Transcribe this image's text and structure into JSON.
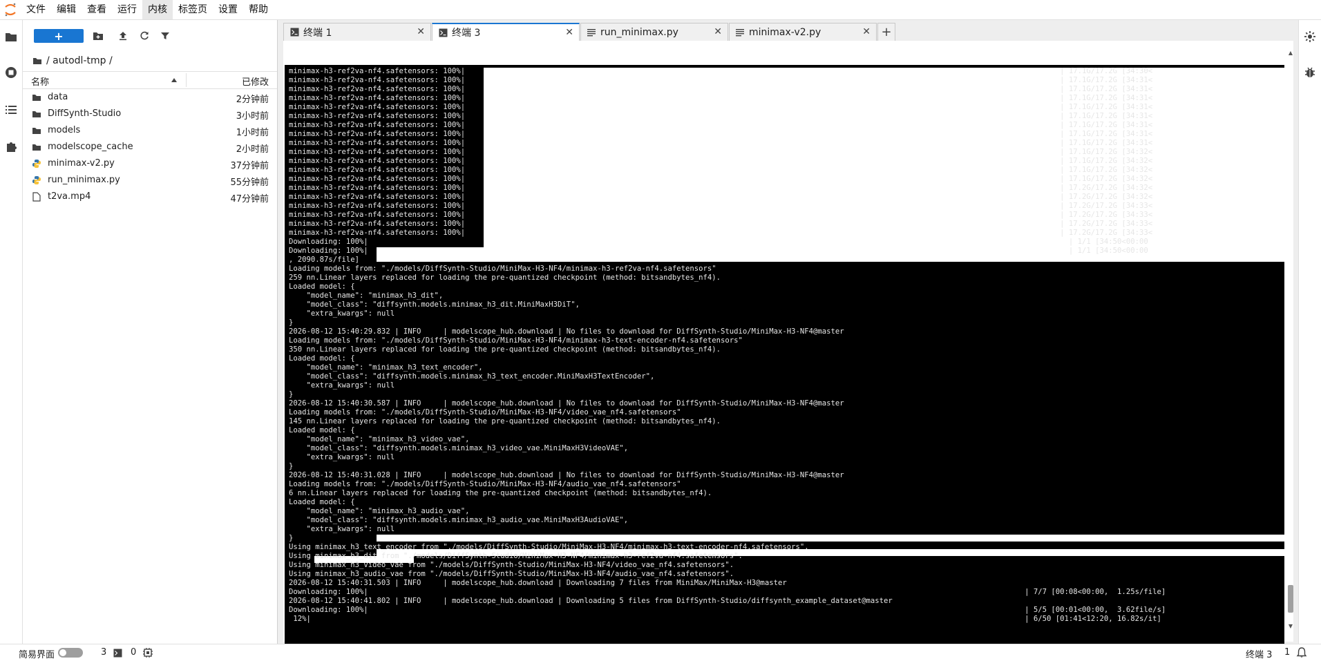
{
  "menubar": {
    "items": [
      "文件",
      "编辑",
      "查看",
      "运行",
      "内核",
      "标签页",
      "设置",
      "帮助"
    ],
    "active": "内核",
    "logo_icon": "jupyter-logo-icon"
  },
  "colors": {
    "accent": "#1976d2",
    "python": "#3776ab",
    "terminal_bg": "#000000"
  },
  "file_browser": {
    "new_button": "+",
    "breadcrumb": "/ autodl-tmp /",
    "columns": {
      "name": "名称",
      "modified": "已修改"
    },
    "files": [
      {
        "name": "data",
        "type": "folder",
        "modified": "2分钟前"
      },
      {
        "name": "DiffSynth-Studio",
        "type": "folder",
        "modified": "3小时前"
      },
      {
        "name": "models",
        "type": "folder",
        "modified": "1小时前"
      },
      {
        "name": "modelscope_cache",
        "type": "folder",
        "modified": "2小时前"
      },
      {
        "name": "minimax-v2.py",
        "type": "python",
        "modified": "37分钟前"
      },
      {
        "name": "run_minimax.py",
        "type": "python",
        "modified": "55分钟前"
      },
      {
        "name": "t2va.mp4",
        "type": "file",
        "modified": "47分钟前"
      }
    ]
  },
  "tabs": [
    {
      "label": "终端 1",
      "icon": "terminal-icon",
      "active": false
    },
    {
      "label": "终端 3",
      "icon": "terminal-icon",
      "active": true
    },
    {
      "label": "run_minimax.py",
      "icon": "text-file-icon",
      "active": false
    },
    {
      "label": "minimax-v2.py",
      "icon": "text-file-icon",
      "active": false
    }
  ],
  "add_tab_label": "+",
  "terminal": {
    "lines": [
      "minimax-h3-ref2va-nf4.safetensors: 100%|                                                                                                                                       | 17.1G/17.2G [34:30<",
      "minimax-h3-ref2va-nf4.safetensors: 100%|                                                                                                                                       | 17.1G/17.2G [34:31<",
      "minimax-h3-ref2va-nf4.safetensors: 100%|                                                                                                                                       | 17.1G/17.2G [34:31<",
      "minimax-h3-ref2va-nf4.safetensors: 100%|                                                                                                                                       | 17.1G/17.2G [34:31<",
      "minimax-h3-ref2va-nf4.safetensors: 100%|                                                                                                                                       | 17.1G/17.2G [34:31<",
      "minimax-h3-ref2va-nf4.safetensors: 100%|                                                                                                                                       | 17.1G/17.2G [34:31<",
      "minimax-h3-ref2va-nf4.safetensors: 100%|                                                                                                                                       | 17.1G/17.2G [34:31<",
      "minimax-h3-ref2va-nf4.safetensors: 100%|                                                                                                                                       | 17.1G/17.2G [34:31<",
      "minimax-h3-ref2va-nf4.safetensors: 100%|                                                                                                                                       | 17.1G/17.2G [34:31<",
      "minimax-h3-ref2va-nf4.safetensors: 100%|                                                                                                                                       | 17.1G/17.2G [34:32<",
      "minimax-h3-ref2va-nf4.safetensors: 100%|                                                                                                                                       | 17.1G/17.2G [34:32<",
      "minimax-h3-ref2va-nf4.safetensors: 100%|                                                                                                                                       | 17.1G/17.2G [34:32<",
      "minimax-h3-ref2va-nf4.safetensors: 100%|                                                                                                                                       | 17.1G/17.2G [34:32<",
      "minimax-h3-ref2va-nf4.safetensors: 100%|                                                                                                                                       | 17.2G/17.2G [34:32<",
      "minimax-h3-ref2va-nf4.safetensors: 100%|                                                                                                                                       | 17.2G/17.2G [34:32<",
      "minimax-h3-ref2va-nf4.safetensors: 100%|                                                                                                                                       | 17.2G/17.2G [34:33<",
      "minimax-h3-ref2va-nf4.safetensors: 100%|                                                                                                                                       | 17.2G/17.2G [34:33<",
      "minimax-h3-ref2va-nf4.safetensors: 100%|                                                                                                                                       | 17.2G/17.2G [34:33<",
      "minimax-h3-ref2va-nf4.safetensors: 100%|                                                                                                                                       | 17.2G/17.2G [34:33<",
      "Downloading: 100%|                                                                                                                                                               | 1/1 [34:50<00:00",
      "Downloading: 100%|                                                                                                                                                               | 1/1 [34:50<00:00",
      ", 2090.87s/file]",
      "Loading models from: \"./models/DiffSynth-Studio/MiniMax-H3-NF4/minimax-h3-ref2va-nf4.safetensors\"",
      "259 nn.Linear layers replaced for loading the pre-quantized checkpoint (method: bitsandbytes_nf4).",
      "Loaded model: {",
      "    \"model_name\": \"minimax_h3_dit\",",
      "    \"model_class\": \"diffsynth.models.minimax_h3_dit.MiniMaxH3DiT\",",
      "    \"extra_kwargs\": null",
      "}",
      "2026-08-12 15:40:29.832 | INFO     | modelscope_hub.download | No files to download for DiffSynth-Studio/MiniMax-H3-NF4@master",
      "Loading models from: \"./models/DiffSynth-Studio/MiniMax-H3-NF4/minimax-h3-text-encoder-nf4.safetensors\"",
      "350 nn.Linear layers replaced for loading the pre-quantized checkpoint (method: bitsandbytes_nf4).",
      "Loaded model: {",
      "    \"model_name\": \"minimax_h3_text_encoder\",",
      "    \"model_class\": \"diffsynth.models.minimax_h3_text_encoder.MiniMaxH3TextEncoder\",",
      "    \"extra_kwargs\": null",
      "}",
      "2026-08-12 15:40:30.587 | INFO     | modelscope_hub.download | No files to download for DiffSynth-Studio/MiniMax-H3-NF4@master",
      "Loading models from: \"./models/DiffSynth-Studio/MiniMax-H3-NF4/video_vae_nf4.safetensors\"",
      "145 nn.Linear layers replaced for loading the pre-quantized checkpoint (method: bitsandbytes_nf4).",
      "Loaded model: {",
      "    \"model_name\": \"minimax_h3_video_vae\",",
      "    \"model_class\": \"diffsynth.models.minimax_h3_video_vae.MiniMaxH3VideoVAE\",",
      "    \"extra_kwargs\": null",
      "}",
      "2026-08-12 15:40:31.028 | INFO     | modelscope_hub.download | No files to download for DiffSynth-Studio/MiniMax-H3-NF4@master",
      "Loading models from: \"./models/DiffSynth-Studio/MiniMax-H3-NF4/audio_vae_nf4.safetensors\"",
      "6 nn.Linear layers replaced for loading the pre-quantized checkpoint (method: bitsandbytes_nf4).",
      "Loaded model: {",
      "    \"model_name\": \"minimax_h3_audio_vae\",",
      "    \"model_class\": \"diffsynth.models.minimax_h3_audio_vae.MiniMaxH3AudioVAE\",",
      "    \"extra_kwargs\": null",
      "}",
      "Using minimax_h3_text_encoder from \"./models/DiffSynth-Studio/MiniMax-H3-NF4/minimax-h3-text-encoder-nf4.safetensors\".",
      "Using minimax_h3_dit from \"./models/DiffSynth-Studio/MiniMax-H3-NF4/minimax-h3-ref2va-nf4.safetensors\".",
      "Using minimax_h3_video_vae from \"./models/DiffSynth-Studio/MiniMax-H3-NF4/video_vae_nf4.safetensors\".",
      "Using minimax_h3_audio_vae from \"./models/DiffSynth-Studio/MiniMax-H3-NF4/audio_vae_nf4.safetensors\".",
      "2026-08-12 15:40:31.503 | INFO     | modelscope_hub.download | Downloading 7 files from MiniMax/MiniMax-H3@master",
      "Downloading: 100%|                                                                                                                                                     | 7/7 [00:08<00:00,  1.25s/file]",
      "2026-08-12 15:40:41.802 | INFO     | modelscope_hub.download | Downloading 5 files from DiffSynth-Studio/diffsynth_example_dataset@master",
      "Downloading: 100%|                                                                                                                                                     | 5/5 [00:01<00:00,  3.62file/s]",
      " 12%|                                                                                                                                                                  | 6/50 [01:41<12:20, 16.82s/it]"
    ],
    "final_progress": 0.12
  },
  "statusbar": {
    "simple_mode_label": "简易界面",
    "kernel_count": "3",
    "terminal_count": "0",
    "right_label": "终端 3",
    "right_count": "1"
  }
}
